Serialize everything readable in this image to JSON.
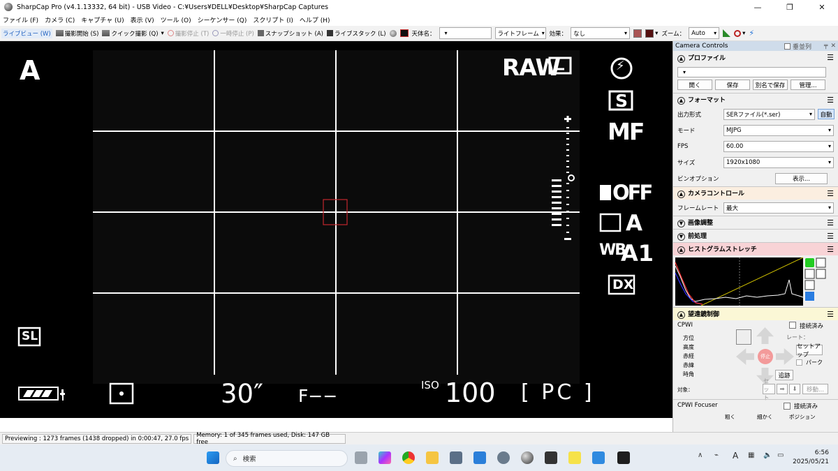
{
  "window": {
    "title": "SharpCap Pro (v4.1.13332, 64 bit) - USB Video - C:¥Users¥DELL¥Desktop¥SharpCap Captures",
    "controls": [
      "—",
      "❐",
      "✕"
    ]
  },
  "menu": [
    "ファイル (F)",
    "カメラ (C)",
    "キャプチャ (U)",
    "表示 (V)",
    "ツール (O)",
    "シーケンサー (Q)",
    "スクリプト (I)",
    "ヘルプ (H)"
  ],
  "toolbar": {
    "live_view": "ライブビュー (W)",
    "start_capture": "撮影開始 (S)",
    "quick_capture": "クイック撮影 (Q)",
    "stop_capture": "撮影停止 (T)",
    "pause": "一時停止 (P)",
    "snapshot": "スナップショット (A)",
    "live_stack": "ライブスタック (L)",
    "target_label": "天体名：",
    "target_value": "",
    "frame_type": "ライトフレーム",
    "effect_label": "効果：",
    "effect_value": "なし",
    "zoom_label": "ズーム：",
    "zoom_value": "Auto"
  },
  "camera_osd": {
    "mode": "A",
    "raw": "RAW",
    "flash": "⚡",
    "metering_s": "S",
    "focus": "MF",
    "face_detect": "OFF",
    "dynamic_range": "A",
    "wb": "WB",
    "wb_value": "A1",
    "crop": "DX",
    "scale_plus": "+",
    "scale_zero": "0",
    "scale_minus": "−",
    "sl": "SL",
    "shutter": "30″",
    "aperture": "F−−",
    "iso_label": "ISO",
    "iso_value": "100",
    "pc": "[ PC ]"
  },
  "panel": {
    "title": "Camera Controls",
    "tile_label": "垂並列",
    "profile": {
      "header": "プロファイル",
      "value": "",
      "buttons": [
        "開く",
        "保存",
        "別名で保存",
        "管理..."
      ]
    },
    "format": {
      "header": "フォーマット",
      "rows": [
        {
          "label": "出力形式",
          "value": "SERファイル(*.ser)"
        },
        {
          "label": "モード",
          "value": "MJPG"
        },
        {
          "label": "FPS",
          "value": "60.00"
        },
        {
          "label": "サイズ",
          "value": "1920x1080"
        }
      ],
      "auto_button": "自動",
      "binning_label": "ビンオプション",
      "binning_button": "表示..."
    },
    "camera_control": {
      "header": "カメラコントロール",
      "framerate_label": "フレームレート",
      "framerate_value": "最大"
    },
    "image_adjust": {
      "header": "画像調整"
    },
    "preprocess": {
      "header": "前処理"
    },
    "histogram": {
      "header": "ヒストグラムストレッチ"
    },
    "telescope": {
      "header": "望遠鏡制御",
      "mount": "CPWI",
      "connected": "接続済み",
      "labels": [
        "方位",
        "高度",
        "赤経",
        "赤緯",
        "時角"
      ],
      "rate_label": "レート：",
      "stop": "停止",
      "setup": "セットアップ",
      "park": "パーク",
      "track": "追跡",
      "target_label": "対象：",
      "set": "セット",
      "move": "移動..."
    },
    "focuser": {
      "name": "CPWI Focuser",
      "connected": "接続済み",
      "labels": [
        "粗く",
        "細かく",
        "ポジション"
      ]
    }
  },
  "status": {
    "preview": "Previewing : 1273 frames (1438 dropped) in 0:00:47, 27.0 fps",
    "memory": "Memory: 1 of 345 frames used, Disk: 147 GB free"
  },
  "taskbar": {
    "search": "検索",
    "time": "6:56",
    "date": "2025/05/21",
    "ime": "A"
  }
}
